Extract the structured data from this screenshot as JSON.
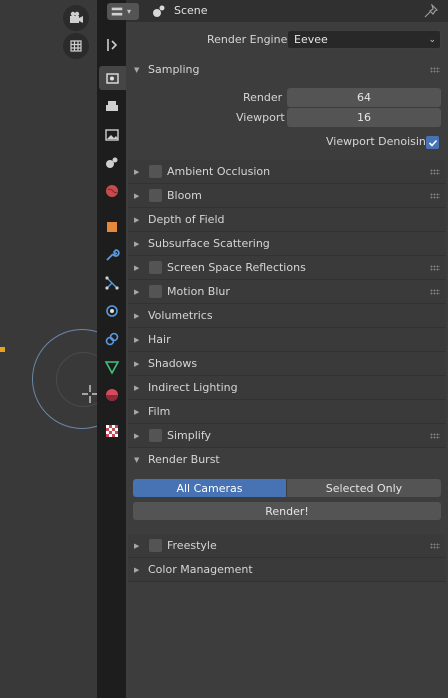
{
  "header": {
    "scene_label": "Scene"
  },
  "render_engine": {
    "label": "Render Engine",
    "value": "Eevee"
  },
  "sampling": {
    "title": "Sampling",
    "render_label": "Render",
    "render_value": "64",
    "viewport_label": "Viewport",
    "viewport_value": "16",
    "denoise_label": "Viewport Denoising",
    "denoise_checked": true
  },
  "sections": [
    {
      "label": "Ambient Occlusion",
      "checkbox": true
    },
    {
      "label": "Bloom",
      "checkbox": true
    },
    {
      "label": "Depth of Field",
      "checkbox": false
    },
    {
      "label": "Subsurface Scattering",
      "checkbox": false
    },
    {
      "label": "Screen Space Reflections",
      "checkbox": true
    },
    {
      "label": "Motion Blur",
      "checkbox": true
    },
    {
      "label": "Volumetrics",
      "checkbox": false
    },
    {
      "label": "Hair",
      "checkbox": false
    },
    {
      "label": "Shadows",
      "checkbox": false
    },
    {
      "label": "Indirect Lighting",
      "checkbox": false
    },
    {
      "label": "Film",
      "checkbox": false
    },
    {
      "label": "Simplify",
      "checkbox": true
    }
  ],
  "render_burst": {
    "title": "Render Burst",
    "all_cameras": "All Cameras",
    "selected_only": "Selected Only",
    "render_button": "Render!"
  },
  "bottom_sections": [
    {
      "label": "Freestyle",
      "checkbox": true
    },
    {
      "label": "Color Management",
      "checkbox": false
    }
  ],
  "colors": {
    "accent": "#4772b3",
    "marker": "#e7a11e",
    "panel": "#3d3d3d"
  }
}
